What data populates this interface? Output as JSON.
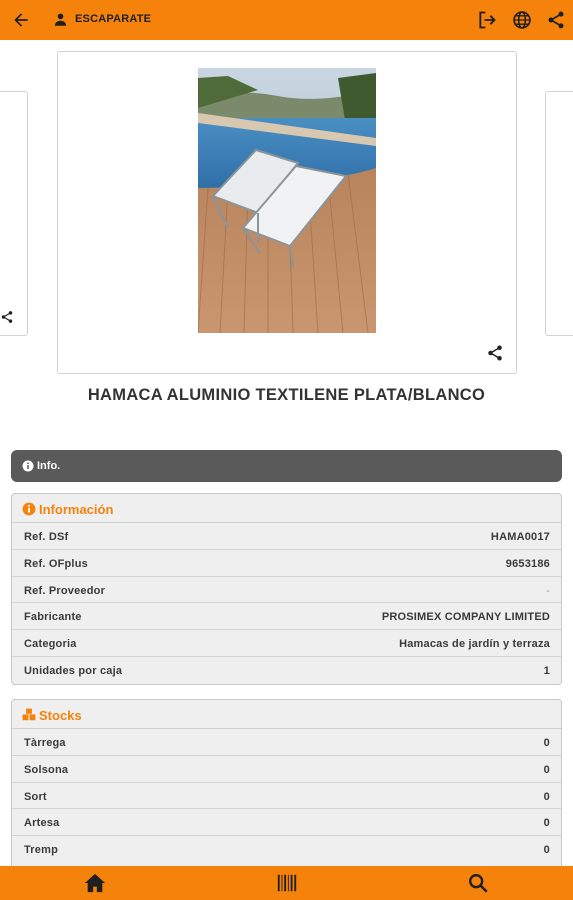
{
  "header": {
    "title": "ESCAPARATE",
    "icons": [
      "back-arrow-icon",
      "user-icon",
      "logout-icon",
      "globe-icon",
      "share-icon"
    ]
  },
  "product": {
    "title": "HAMACA ALUMINIO TEXTILENE PLATA/BLANCO",
    "image": "photo of two aluminium textilene deck chairs on a wooden deck by a pool"
  },
  "info_bar": {
    "label": "Info."
  },
  "informacion": {
    "title": "Información",
    "rows": [
      {
        "key": "Ref. DSf",
        "value": "HAMA0017"
      },
      {
        "key": "Ref. OFplus",
        "value": "9653186"
      },
      {
        "key": "Ref. Proveedor",
        "value": "-"
      },
      {
        "key": "Fabricante",
        "value": "PROSIMEX COMPANY LIMITED"
      },
      {
        "key": "Categoria",
        "value": "Hamacas de jardín y terraza"
      },
      {
        "key": "Unidades por caja",
        "value": "1"
      }
    ]
  },
  "stocks": {
    "title": "Stocks",
    "rows": [
      {
        "key": "Tàrrega",
        "value": "0"
      },
      {
        "key": "Solsona",
        "value": "0"
      },
      {
        "key": "Sort",
        "value": "0"
      },
      {
        "key": "Artesa",
        "value": "0"
      },
      {
        "key": "Tremp",
        "value": "0"
      }
    ]
  },
  "bottom_nav": {
    "items": [
      "home-icon",
      "barcode-icon",
      "search-icon"
    ]
  },
  "colors": {
    "accent": "#f5820b",
    "info_bar": "#5a5a5a",
    "panel_bg": "#efefef"
  }
}
